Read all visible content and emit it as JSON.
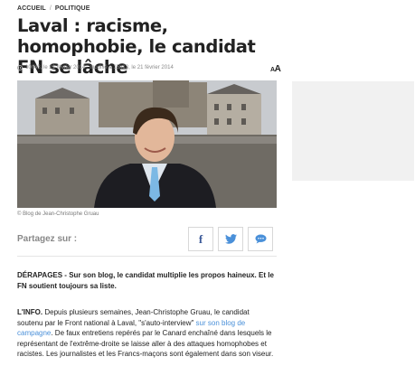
{
  "breadcrumb": {
    "home": "ACCUEIL",
    "separator": "/",
    "section": "POLITIQUE"
  },
  "article": {
    "title": "Laval : racisme, homophobie, le candidat FN se lâche",
    "meta": "10h43, le 21 février 2014 , modifié à 15h13, le 21 février 2014",
    "font_size_label_small": "A",
    "font_size_label_large": "A",
    "photo_caption": "© Blog de Jean-Christophe Gruau",
    "share_label": "Partagez sur :",
    "chapo": "DÉRAPAGES - Sur son blog, le candidat multiplie les propos haineux. Et le FN soutient toujours sa liste.",
    "body_lead": "L'INFO.",
    "body_part1": " Depuis plusieurs semaines, Jean-Christophe Gruau, le candidat soutenu par le Front national à Laval, \"s'auto-interview\" ",
    "body_link": "sur son blog de campagne",
    "body_part2": ". De faux entretiens repérés par le Canard enchaîné dans lesquels le représentant de l'extrême-droite se laisse aller à des attaques homophobes et racistes. Les journalistes et les Francs-maçons sont également dans son viseur."
  },
  "icons": {
    "clock": "clock-icon",
    "facebook": "facebook-icon",
    "twitter": "twitter-icon",
    "comment": "comment-icon"
  },
  "colors": {
    "facebook": "#3b5998",
    "twitter": "#4a90d9",
    "link": "#4a90d9",
    "comment": "#4a90d9"
  }
}
